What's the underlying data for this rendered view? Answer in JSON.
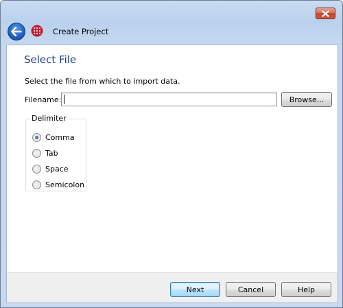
{
  "window": {
    "close_icon": "close-icon"
  },
  "header": {
    "title": "Create Project",
    "back_icon": "back-arrow-icon",
    "app_icon": "app-grid-icon"
  },
  "page": {
    "title": "Select File",
    "instruction": "Select the file from which to import data."
  },
  "filename": {
    "label": "Filename:",
    "value": "",
    "browse_label": "Browse..."
  },
  "delimiter": {
    "legend": "Delimiter",
    "selected": "Comma",
    "options": [
      {
        "label": "Comma",
        "checked": true
      },
      {
        "label": "Tab",
        "checked": false
      },
      {
        "label": "Space",
        "checked": false
      },
      {
        "label": "Semicolon",
        "checked": false
      }
    ]
  },
  "footer": {
    "next_label": "Next",
    "cancel_label": "Cancel",
    "help_label": "Help"
  },
  "colors": {
    "title_blue": "#1e3f8f",
    "close_red": "#c2442b",
    "chrome_blue": "#c6d9f1"
  }
}
